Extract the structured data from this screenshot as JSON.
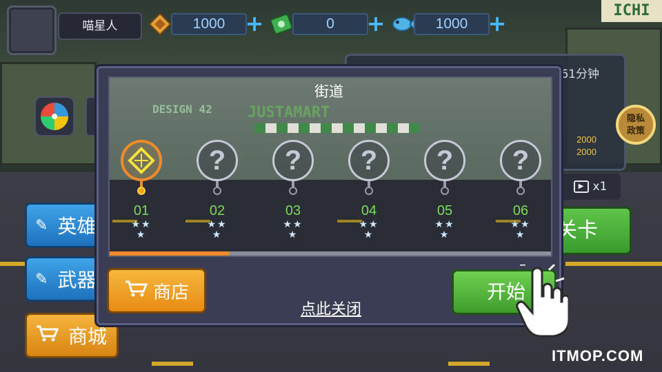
{
  "topbar": {
    "player_name": "喵星人",
    "resources": [
      {
        "icon": "gem-coin-icon",
        "value": "1000"
      },
      {
        "icon": "cash-icon",
        "value": "0"
      },
      {
        "icon": "fish-icon",
        "value": "1000"
      }
    ],
    "plus_label": "+"
  },
  "background": {
    "timer_text": "61分钟",
    "reward_values": [
      "2000",
      "2000"
    ],
    "privacy_label": "隐私政策",
    "speed_label": "x1",
    "level_button_label": "关卡",
    "side_buttons": [
      "英雄",
      "武器",
      "商城"
    ],
    "store_signs": [
      "DESIGN 42",
      "JUSTAMART"
    ],
    "top_sign": "ICHI"
  },
  "modal": {
    "title": "街道",
    "levels": [
      {
        "number": "01",
        "state": "unlocked",
        "stars": 3
      },
      {
        "number": "02",
        "state": "locked",
        "stars": 3
      },
      {
        "number": "03",
        "state": "locked",
        "stars": 3
      },
      {
        "number": "04",
        "state": "locked",
        "stars": 3
      },
      {
        "number": "05",
        "state": "locked",
        "stars": 3
      },
      {
        "number": "06",
        "state": "locked",
        "stars": 3
      }
    ],
    "locked_symbol": "?",
    "scroll_progress": 0.27,
    "shop_button": "商店",
    "close_link": "点此关闭",
    "start_button": "开始"
  },
  "watermark": "ITMOP.COM",
  "colors": {
    "accent_orange": "#f08a2a",
    "level_number_green": "#7bdc58",
    "start_green": "#4cb536",
    "shop_orange": "#f0a02a"
  }
}
